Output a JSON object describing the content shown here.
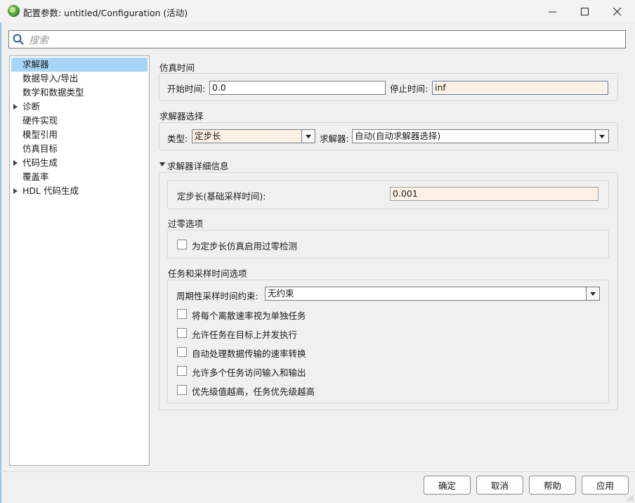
{
  "window": {
    "title": "配置参数: untitled/Configuration (活动)",
    "controls": [
      "minimize-icon",
      "maximize-icon",
      "close-icon"
    ]
  },
  "search": {
    "placeholder": "搜索"
  },
  "tree": {
    "items": [
      {
        "label": "求解器",
        "expandable": false,
        "selected": true
      },
      {
        "label": "数据导入/导出",
        "expandable": false
      },
      {
        "label": "数学和数据类型",
        "expandable": false
      },
      {
        "label": "诊断",
        "expandable": true
      },
      {
        "label": "硬件实现",
        "expandable": false
      },
      {
        "label": "模型引用",
        "expandable": false
      },
      {
        "label": "仿真目标",
        "expandable": false
      },
      {
        "label": "代码生成",
        "expandable": true
      },
      {
        "label": "覆盖率",
        "expandable": false
      },
      {
        "label": "HDL 代码生成",
        "expandable": true
      }
    ]
  },
  "sim_time": {
    "title": "仿真时间",
    "start_label": "开始时间:",
    "start_value": "0.0",
    "stop_label": "停止时间:",
    "stop_value": "inf"
  },
  "solver_select": {
    "title": "求解器选择",
    "type_label": "类型:",
    "type_value": "定步长",
    "solver_label": "求解器:",
    "solver_value": "自动(自动求解器选择)"
  },
  "solver_details": {
    "title": "求解器详细信息",
    "step_label": "定步长(基础采样时间):",
    "step_value": "0.001",
    "zero_crossing": {
      "title": "过零选项",
      "checkbox_label": "为定步长仿真启用过零检测",
      "checked": false
    },
    "tasking": {
      "title": "任务和采样时间选项",
      "constraint_label": "周期性采样时间约束:",
      "constraint_value": "无约束",
      "options": [
        {
          "label": "将每个离散速率视为单独任务",
          "checked": false
        },
        {
          "label": "允许任务在目标上并发执行",
          "checked": false
        },
        {
          "label": "自动处理数据传输的速率转换",
          "checked": false
        },
        {
          "label": "允许多个任务访问输入和输出",
          "checked": false
        },
        {
          "label": "优先级值越高，任务优先级越高",
          "checked": false
        }
      ]
    }
  },
  "buttons": {
    "ok": "确定",
    "cancel": "取消",
    "help": "帮助",
    "apply": "应用"
  }
}
